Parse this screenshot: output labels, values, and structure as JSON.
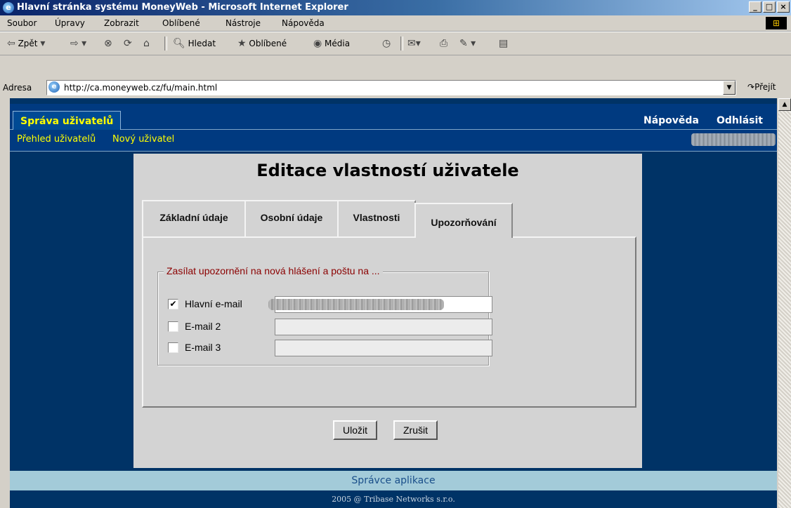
{
  "window": {
    "title": "Hlavní stránka systému MoneyWeb - Microsoft Internet Explorer",
    "minimize": "_",
    "maximize": "□",
    "close": "×"
  },
  "menu": [
    "Soubor",
    "Úpravy",
    "Zobrazit",
    "Oblíbené",
    "Nástroje",
    "Nápověda"
  ],
  "toolbar": {
    "back": "Zpět",
    "search": "Hledat",
    "favorites": "Oblíbené",
    "media": "Média"
  },
  "address": {
    "label": "Adresa",
    "url": "http://ca.moneyweb.cz/fu/main.html",
    "go": "Přejít"
  },
  "header": {
    "tab": "Správa uživatelů",
    "help": "Nápověda",
    "logout": "Odhlásit"
  },
  "subnav": {
    "overview": "Přehled uživatelů",
    "new_user": "Nový uživatel"
  },
  "panel": {
    "title": "Editace vlastností uživatele",
    "tabs": [
      "Základní údaje",
      "Osobní údaje",
      "Vlastnosti",
      "Upozorňování"
    ],
    "active_tab": "Upozorňování",
    "fieldset_legend": "Zasílat upozornění na nová hlášení a poštu na ...",
    "rows": [
      {
        "label": "Hlavní e-mail",
        "checked": true
      },
      {
        "label": "E-mail 2",
        "checked": false
      },
      {
        "label": "E-mail 3",
        "checked": false
      }
    ],
    "save": "Uložit",
    "cancel": "Zrušit"
  },
  "footer": {
    "admin": "Správce aplikace",
    "copyright": "2005 @ Tribase Networks s.r.o."
  },
  "colors": {
    "page_bg": "#003366",
    "accent_yellow": "#ffff00",
    "legend_red": "#8b0000",
    "footer_bg": "#a3cbd9"
  }
}
